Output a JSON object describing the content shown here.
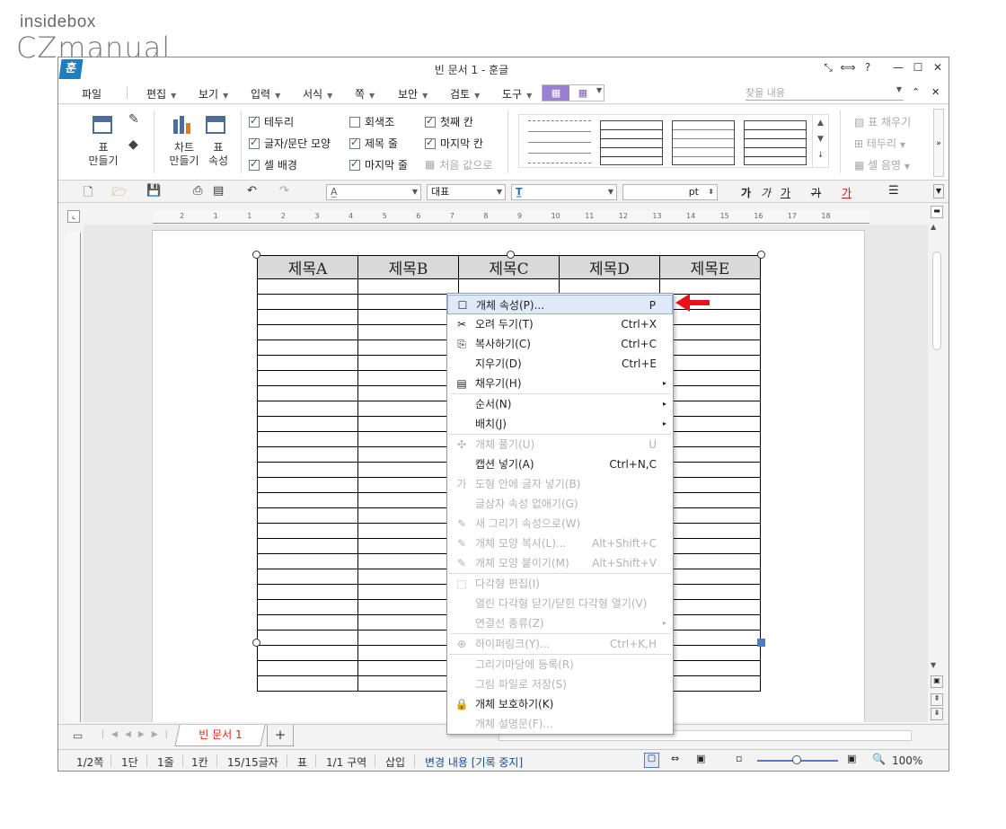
{
  "watermark": {
    "line1": "insidebox",
    "line2": "CZmanual"
  },
  "window": {
    "app_icon": "훈",
    "title": "빈 문서 1 - 훈글",
    "controls": [
      "✕⃞",
      "↔",
      "?",
      "—",
      "☐",
      "✕"
    ]
  },
  "menubar": {
    "items": [
      "파일",
      "편집",
      "보기",
      "입력",
      "서식",
      "쪽",
      "보안",
      "검토",
      "도구"
    ],
    "search_placeholder": "찾을 내용"
  },
  "ribbon": {
    "table_make": "표\n만들기",
    "chart_make": "차트\n만들기",
    "table_props": "표\n속성",
    "checks": [
      {
        "label": "테두리",
        "checked": true
      },
      {
        "label": "글자/문단 모양",
        "checked": true
      },
      {
        "label": "셀 배경",
        "checked": true
      },
      {
        "label": "회색조",
        "checked": false
      },
      {
        "label": "제목 줄",
        "checked": true
      },
      {
        "label": "마지막 줄",
        "checked": true
      },
      {
        "label": "첫째 칸",
        "checked": true
      },
      {
        "label": "마지막 칸",
        "checked": true
      },
      {
        "label": "처음 값으로",
        "checked": false
      }
    ],
    "right_items": [
      "표 채우기",
      "테두리",
      "셀 음영"
    ]
  },
  "toolbar2": {
    "style_combo": "",
    "font_kind": "대표",
    "font_combo": "",
    "size_unit": "pt",
    "format_buttons": [
      "가",
      "가",
      "가",
      "가",
      "가"
    ]
  },
  "ruler_numbers": [
    "2",
    "1",
    "1",
    "2",
    "3",
    "4",
    "5",
    "6",
    "7",
    "8",
    "9",
    "10",
    "11",
    "12",
    "13",
    "14",
    "15",
    "16",
    "17",
    "18"
  ],
  "table": {
    "headers": [
      "제목A",
      "제목B",
      "제목C",
      "제목D",
      "제목E"
    ],
    "row_count": 27
  },
  "context_menu": {
    "items": [
      {
        "icon": "☐",
        "label": "개체 속성(P)...",
        "shortcut": "P",
        "disabled": false,
        "highlight": true
      },
      {
        "icon": "✂",
        "label": "오려 두기(T)",
        "shortcut": "Ctrl+X",
        "disabled": false
      },
      {
        "icon": "⎘",
        "label": "복사하기(C)",
        "shortcut": "Ctrl+C",
        "disabled": false
      },
      {
        "icon": "",
        "label": "지우기(D)",
        "shortcut": "Ctrl+E",
        "disabled": false
      },
      {
        "icon": "▤",
        "label": "채우기(H)",
        "shortcut": "",
        "disabled": false,
        "submenu": true,
        "sep_after": true
      },
      {
        "icon": "",
        "label": "순서(N)",
        "shortcut": "",
        "disabled": false,
        "submenu": true
      },
      {
        "icon": "",
        "label": "배치(J)",
        "shortcut": "",
        "disabled": false,
        "submenu": true,
        "sep_after": true
      },
      {
        "icon": "✣",
        "label": "개체 풀기(U)",
        "shortcut": "U",
        "disabled": true
      },
      {
        "icon": "",
        "label": "캡션 넣기(A)",
        "shortcut": "Ctrl+N,C",
        "disabled": false
      },
      {
        "icon": "가",
        "label": "도형 안에 글자 넣기(B)",
        "shortcut": "",
        "disabled": true
      },
      {
        "icon": "",
        "label": "글상자 속성 없애기(G)",
        "shortcut": "",
        "disabled": true
      },
      {
        "icon": "✎",
        "label": "새 그리기 속성으로(W)",
        "shortcut": "",
        "disabled": true
      },
      {
        "icon": "✎",
        "label": "개체 모양 복사(L)...",
        "shortcut": "Alt+Shift+C",
        "disabled": true
      },
      {
        "icon": "✎",
        "label": "개체 모양 붙이기(M)",
        "shortcut": "Alt+Shift+V",
        "disabled": true,
        "sep_after": true
      },
      {
        "icon": "⬚",
        "label": "다각형 편집(I)",
        "shortcut": "",
        "disabled": true
      },
      {
        "icon": "",
        "label": "열린 다각형 닫기/닫힌 다각형 열기(V)",
        "shortcut": "",
        "disabled": true
      },
      {
        "icon": "",
        "label": "연결선 종류(Z)",
        "shortcut": "",
        "disabled": true,
        "submenu": true,
        "sep_after": true
      },
      {
        "icon": "⊕",
        "label": "하이퍼링크(Y)...",
        "shortcut": "Ctrl+K,H",
        "disabled": true,
        "sep_after": true
      },
      {
        "icon": "",
        "label": "그리기마당에 등록(R)",
        "shortcut": "",
        "disabled": true
      },
      {
        "icon": "",
        "label": "그림 파일로 저장(S)",
        "shortcut": "",
        "disabled": true
      },
      {
        "icon": "🔒",
        "label": "개체 보호하기(K)",
        "shortcut": "",
        "disabled": false
      },
      {
        "icon": "",
        "label": "개체 설명문(F)...",
        "shortcut": "",
        "disabled": true
      }
    ]
  },
  "tabbar": {
    "doc_tab": "빈 문서 1",
    "add": "+"
  },
  "statusbar": {
    "items": [
      "1/2쪽",
      "1단",
      "1줄",
      "1칸",
      "15/15글자",
      "표",
      "1/1 구역",
      "삽입",
      "변경 내용 [기록 중지]"
    ],
    "zoom": "100%"
  },
  "colors": {
    "accent_red": "#e8121b",
    "menu_highlight": "#dfe9f8",
    "app_blue": "#1d7fc2"
  }
}
